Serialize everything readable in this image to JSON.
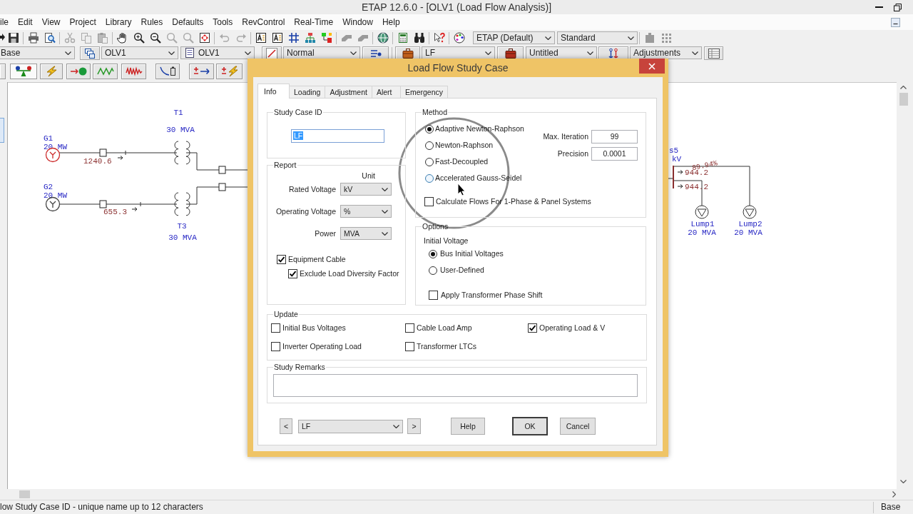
{
  "window": {
    "title": "ETAP 12.6.0 - [OLV1 (Load Flow Analysis)]"
  },
  "menu": [
    {
      "label": "ile"
    },
    {
      "label": "Edit"
    },
    {
      "label": "View"
    },
    {
      "label": "Project"
    },
    {
      "label": "Library"
    },
    {
      "label": "Rules"
    },
    {
      "label": "Defaults"
    },
    {
      "label": "Tools"
    },
    {
      "label": "RevControl"
    },
    {
      "label": "Real-Time"
    },
    {
      "label": "Window"
    },
    {
      "label": "Help"
    }
  ],
  "toolbar_1": {
    "dropdowns": [
      "ETAP (Default)",
      "Standard"
    ]
  },
  "toolbar_2": {
    "dropdowns": [
      "Base",
      "OLV1",
      "OLV1",
      "Normal",
      "LF",
      "Untitled",
      "Adjustments"
    ]
  },
  "diagram": {
    "generators": [
      {
        "name": "G1",
        "rating": "20 MW",
        "flow": "1240.6",
        "color": "#cc2a2a"
      },
      {
        "name": "G2",
        "rating": "20 MW",
        "flow": "655.3",
        "color": "#444444"
      }
    ],
    "transformers": [
      {
        "name": "T1",
        "rating": "30 MVA"
      },
      {
        "name": "T3",
        "rating": "30 MVA"
      }
    ],
    "bus": {
      "name": "s5",
      "voltage": "kV",
      "feeders": [
        {
          "flow": "944.2",
          "loading": "89.94%"
        },
        {
          "flow": "944.2"
        }
      ]
    },
    "loads": [
      {
        "name": "Lump1",
        "rating": "20 MVA"
      },
      {
        "name": "Lump2",
        "rating": "20 MVA"
      }
    ]
  },
  "dialog": {
    "title": "Load Flow Study Case",
    "tabs": [
      {
        "label": "Info",
        "selected": true
      },
      {
        "label": "Loading",
        "selected": false
      },
      {
        "label": "Adjustment",
        "selected": false
      },
      {
        "label": "Alert",
        "selected": false
      },
      {
        "label": "Emergency",
        "selected": false
      }
    ],
    "study_case_id": {
      "legend": "Study Case ID",
      "value": "LF",
      "highlighted": true
    },
    "report": {
      "legend": "Report",
      "unit_header": "Unit",
      "units": [
        {
          "label": "Rated Voltage",
          "value": "kV"
        },
        {
          "label": "Operating Voltage",
          "value": "%"
        },
        {
          "label": "Power",
          "value": "MVA"
        }
      ],
      "options": [
        {
          "label": "Equipment Cable",
          "checked": true,
          "children": [
            {
              "label": "Exclude Load Diversity Factor",
              "checked": true
            }
          ]
        }
      ]
    },
    "method": {
      "legend": "Method",
      "choices": [
        {
          "label": "Adaptive Newton-Raphson",
          "selected": true,
          "hovered": false
        },
        {
          "label": "Newton-Raphson",
          "selected": false,
          "hovered": false
        },
        {
          "label": "Fast-Decoupled",
          "selected": false,
          "hovered": false
        },
        {
          "label": "Accelerated Gauss-Seidel",
          "selected": false,
          "hovered": true
        }
      ],
      "fields": [
        {
          "label": "Max. Iteration",
          "value": "99"
        },
        {
          "label": "Precision",
          "value": "0.0001"
        }
      ],
      "calculate_flows": {
        "label": "Calculate Flows For 1-Phase & Panel Systems",
        "checked": false
      }
    },
    "options": {
      "legend": "Options",
      "initial_voltage": {
        "heading": "Initial Voltage",
        "choices": [
          {
            "label": "Bus Initial Voltages",
            "selected": true
          },
          {
            "label": "User-Defined",
            "selected": false
          }
        ]
      },
      "phase_shift": {
        "label": "Apply Transformer Phase Shift",
        "checked": false
      }
    },
    "update": {
      "legend": "Update",
      "items": [
        {
          "label": "Initial Bus Voltages",
          "checked": false
        },
        {
          "label": "Cable Load Amp",
          "checked": false
        },
        {
          "label": "Operating Load & V",
          "checked": true
        },
        {
          "label": "Inverter Operating Load",
          "checked": false
        },
        {
          "label": "Transformer LTCs",
          "checked": false
        }
      ]
    },
    "remarks": {
      "legend": "Study Remarks"
    },
    "footer": {
      "previous": "<",
      "case": "LF",
      "next": ">",
      "buttons": [
        {
          "label": "Help",
          "default": false
        },
        {
          "label": "OK",
          "default": true
        },
        {
          "label": "Cancel",
          "default": false
        }
      ]
    }
  },
  "status_bar": {
    "message": "low Study Case ID - unique name up to 12 characters",
    "mode": "Base"
  }
}
